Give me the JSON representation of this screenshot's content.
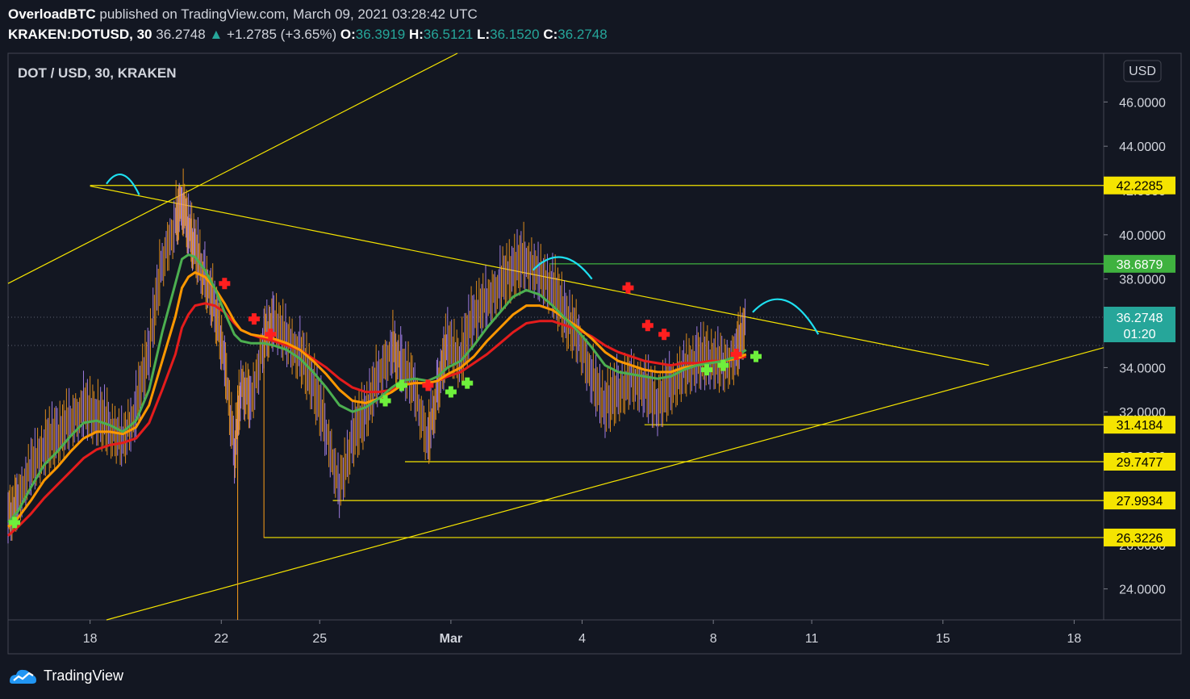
{
  "header": {
    "author": "OverloadBTC",
    "published": "published on TradingView.com, March 09, 2021 03:28:42 UTC",
    "symbol": "KRAKEN:DOTUSD, 30",
    "last": "36.2748",
    "change": "+1.2785 (+3.65%)",
    "o_label": "O:",
    "o_value": "36.3919",
    "h_label": "H:",
    "h_value": "36.5121",
    "l_label": "L:",
    "l_value": "36.1520",
    "c_label": "C:",
    "c_value": "36.2748"
  },
  "footer": {
    "brand": "TradingView"
  },
  "colors": {
    "background": "#131722",
    "grid": "#2a2e39",
    "text": "#d1d4dc",
    "yellow": "#f5e400",
    "green_line": "#4caf50",
    "orange_line": "#ff9800",
    "red_line": "#e51c1c",
    "cyan": "#1ee0f0",
    "signal_green": "#6ef03c",
    "signal_red": "#ff1f1f",
    "price_label_green": "#26a69a",
    "level_green": "#3fb23f"
  },
  "chart_data": {
    "type": "line",
    "title": "DOT / USD, 30, KRAKEN",
    "currency_button": "USD",
    "x_ticks": [
      "18",
      "22",
      "25",
      "Mar",
      "4",
      "8",
      "11",
      "15",
      "18"
    ],
    "x_tick_days": [
      0,
      4,
      7,
      11,
      15,
      19,
      22,
      26,
      30
    ],
    "xlim_days": [
      -2.5,
      30.9
    ],
    "y_ticks": [
      "24.0000",
      "26.0000",
      "28.0000",
      "30.0000",
      "32.0000",
      "34.0000",
      "36.0000",
      "38.0000",
      "40.0000",
      "42.0000",
      "44.0000",
      "46.0000"
    ],
    "ylim": [
      22.6,
      48.2
    ],
    "price_levels": [
      {
        "label": "42.2285",
        "value": 42.2285,
        "style": "yellow"
      },
      {
        "label": "38.6879",
        "value": 38.6879,
        "style": "green"
      },
      {
        "label": "31.4184",
        "value": 31.4184,
        "style": "yellow"
      },
      {
        "label": "29.7477",
        "value": 29.7477,
        "style": "yellow"
      },
      {
        "label": "27.9934",
        "value": 27.9934,
        "style": "yellow"
      },
      {
        "label": "26.3226",
        "value": 26.3226,
        "style": "yellow"
      }
    ],
    "current_price": {
      "label": "36.2748",
      "countdown": "01:20",
      "value": 36.2748
    },
    "trendlines": [
      {
        "name": "upper-channel",
        "points": [
          [
            -2.5,
            37.8
          ],
          [
            11.2,
            48.2
          ]
        ]
      },
      {
        "name": "descending-resistance",
        "points": [
          [
            0,
            42.2
          ],
          [
            27.4,
            34.1
          ]
        ]
      },
      {
        "name": "ascending-support",
        "points": [
          [
            0.5,
            22.6
          ],
          [
            30.9,
            34.9
          ]
        ]
      }
    ],
    "price": {
      "x": [
        -2.5,
        -2.2,
        -1.8,
        -1.4,
        -1.0,
        -0.6,
        -0.2,
        0.2,
        0.6,
        1.0,
        1.4,
        1.8,
        2.2,
        2.6,
        2.8,
        3.0,
        3.2,
        3.5,
        3.8,
        4.1,
        4.4,
        4.6,
        4.9,
        5.3,
        5.6,
        6.0,
        6.4,
        6.8,
        7.2,
        7.6,
        8.0,
        8.4,
        8.8,
        9.2,
        9.5,
        9.9,
        10.3,
        10.6,
        10.9,
        11.3,
        11.7,
        12.1,
        12.5,
        12.9,
        13.3,
        13.7,
        14.1,
        14.5,
        14.9,
        15.3,
        15.7,
        16.1,
        16.5,
        16.9,
        17.3,
        17.7,
        18.1,
        18.5,
        18.9,
        19.3,
        19.7,
        20.0
      ],
      "close": [
        27.2,
        28.1,
        29.6,
        30.4,
        30.9,
        31.7,
        32.2,
        31.8,
        31.3,
        30.8,
        32.1,
        34.8,
        38.9,
        40.6,
        41.5,
        40.3,
        39.4,
        38.1,
        36.7,
        34.4,
        30.1,
        33.2,
        32.5,
        35.3,
        36.2,
        35.4,
        34.6,
        33.2,
        31.2,
        28.6,
        30.8,
        31.9,
        33.8,
        34.9,
        34.2,
        33.1,
        30.7,
        33.1,
        35.2,
        34.3,
        36.4,
        37.1,
        37.8,
        38.4,
        38.9,
        38.3,
        37.6,
        36.2,
        35.4,
        33.6,
        32.2,
        32.9,
        33.6,
        33.1,
        32.3,
        33.2,
        34.0,
        34.3,
        34.4,
        34.2,
        34.7,
        36.2
      ]
    },
    "moving_averages": {
      "green": [
        27.0,
        27.5,
        28.6,
        29.6,
        30.2,
        30.9,
        31.5,
        31.6,
        31.4,
        31.1,
        31.6,
        33.0,
        35.6,
        37.8,
        38.9,
        39.1,
        39.0,
        38.4,
        37.6,
        36.5,
        35.5,
        35.2,
        35.1,
        35.1,
        35.0,
        34.8,
        34.4,
        33.8,
        33.1,
        32.3,
        32.0,
        32.2,
        32.6,
        33.1,
        33.4,
        33.5,
        33.4,
        33.6,
        34.0,
        34.3,
        35.0,
        35.8,
        36.5,
        37.2,
        37.5,
        37.3,
        36.8,
        36.2,
        35.6,
        34.9,
        34.1,
        33.8,
        33.7,
        33.6,
        33.5,
        33.6,
        33.9,
        34.1,
        34.2,
        34.3,
        34.5,
        34.8
      ],
      "orange": [
        26.8,
        27.2,
        28.0,
        28.9,
        29.5,
        30.2,
        30.8,
        31.1,
        31.1,
        31.0,
        31.3,
        32.3,
        34.3,
        36.3,
        37.6,
        38.1,
        38.3,
        38.1,
        37.6,
        36.9,
        36.1,
        35.7,
        35.5,
        35.4,
        35.3,
        35.1,
        34.8,
        34.3,
        33.7,
        33.0,
        32.5,
        32.4,
        32.6,
        32.9,
        33.2,
        33.3,
        33.3,
        33.4,
        33.7,
        34.0,
        34.5,
        35.2,
        35.8,
        36.4,
        36.8,
        36.8,
        36.6,
        36.2,
        35.8,
        35.3,
        34.7,
        34.3,
        34.1,
        33.9,
        33.8,
        33.8,
        34.0,
        34.1,
        34.2,
        34.3,
        34.4,
        34.6
      ],
      "red": [
        26.4,
        26.8,
        27.4,
        28.1,
        28.7,
        29.3,
        29.9,
        30.3,
        30.5,
        30.6,
        30.8,
        31.5,
        33.0,
        34.6,
        35.8,
        36.4,
        36.8,
        36.9,
        36.8,
        36.5,
        36.0,
        35.7,
        35.5,
        35.3,
        35.2,
        35.0,
        34.8,
        34.4,
        34.0,
        33.5,
        33.1,
        32.9,
        32.9,
        33.0,
        33.2,
        33.3,
        33.3,
        33.4,
        33.6,
        33.8,
        34.2,
        34.6,
        35.1,
        35.6,
        36.0,
        36.1,
        36.1,
        35.9,
        35.7,
        35.4,
        35.0,
        34.7,
        34.5,
        34.3,
        34.2,
        34.1,
        34.2,
        34.2,
        34.3,
        34.3,
        34.4,
        34.5
      ]
    },
    "signals": [
      {
        "type": "buy",
        "x": -2.3,
        "y": 27.0
      },
      {
        "type": "sell",
        "x": 4.1,
        "y": 37.8
      },
      {
        "type": "sell",
        "x": 5.0,
        "y": 36.2
      },
      {
        "type": "sell",
        "x": 5.5,
        "y": 35.5
      },
      {
        "type": "buy",
        "x": 9.0,
        "y": 32.5
      },
      {
        "type": "buy",
        "x": 9.5,
        "y": 33.2
      },
      {
        "type": "sell",
        "x": 10.3,
        "y": 33.2
      },
      {
        "type": "buy",
        "x": 11.0,
        "y": 32.9
      },
      {
        "type": "buy",
        "x": 11.5,
        "y": 33.3
      },
      {
        "type": "sell",
        "x": 16.4,
        "y": 37.6
      },
      {
        "type": "sell",
        "x": 17.0,
        "y": 35.9
      },
      {
        "type": "sell",
        "x": 17.5,
        "y": 35.5
      },
      {
        "type": "buy",
        "x": 18.8,
        "y": 33.9
      },
      {
        "type": "buy",
        "x": 19.3,
        "y": 34.1
      },
      {
        "type": "sell",
        "x": 19.7,
        "y": 34.6
      },
      {
        "type": "buy",
        "x": 20.3,
        "y": 34.5
      }
    ],
    "annotations": [
      {
        "name": "peak-arc-1",
        "points": [
          [
            0.5,
            42.3
          ],
          [
            1.0,
            42.7
          ],
          [
            1.5,
            41.8
          ]
        ]
      },
      {
        "name": "peak-arc-2",
        "points": [
          [
            13.5,
            38.4
          ],
          [
            14.4,
            39.1
          ],
          [
            15.3,
            38.0
          ]
        ]
      },
      {
        "name": "projected-arc",
        "points": [
          [
            20.2,
            36.5
          ],
          [
            21.2,
            37.4
          ],
          [
            22.2,
            35.5
          ]
        ]
      }
    ],
    "wick_lows": [
      {
        "x": 4.5,
        "y": 22.6
      },
      {
        "x": 5.3,
        "y": 26.3
      }
    ]
  }
}
